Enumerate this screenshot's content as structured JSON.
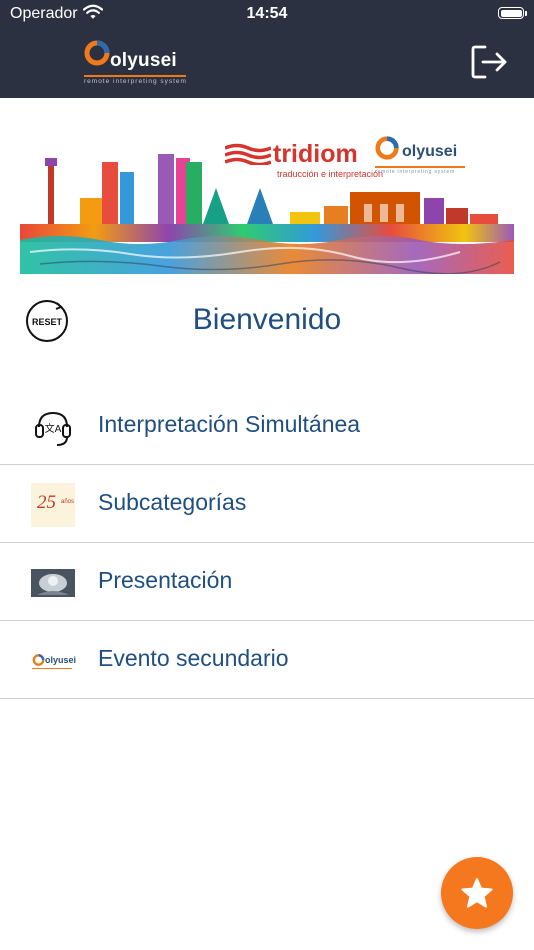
{
  "status_bar": {
    "carrier": "Operador",
    "time": "14:54"
  },
  "header": {
    "brand_name": "olyusei",
    "brand_tagline": "remote interpreting system",
    "logout_icon": "logout-icon"
  },
  "banner": {
    "partner_name": "tridiom",
    "partner_tagline": "traducción e interpretación",
    "brand_name": "olyusei",
    "brand_tagline": "remote interpreting system"
  },
  "welcome": {
    "reset_label": "RESET",
    "title": "Bienvenido"
  },
  "menu": {
    "items": [
      {
        "label": "Interpretación Simultánea",
        "icon": "headset-translate-icon"
      },
      {
        "label": "Subcategorías",
        "icon": "anniversary-25-thumbnail",
        "thumb_number": "25",
        "thumb_caption": "años"
      },
      {
        "label": "Presentación",
        "icon": "presentation-thumbnail"
      },
      {
        "label": "Evento secundario",
        "icon": "olyusei-logo-thumbnail",
        "thumb_text": "olyusei"
      }
    ]
  },
  "fab": {
    "icon": "star-icon"
  },
  "colors": {
    "header_bg": "#2b3140",
    "accent": "#f5781e",
    "text_primary": "#1f4e82",
    "partner_red": "#d6342c"
  }
}
